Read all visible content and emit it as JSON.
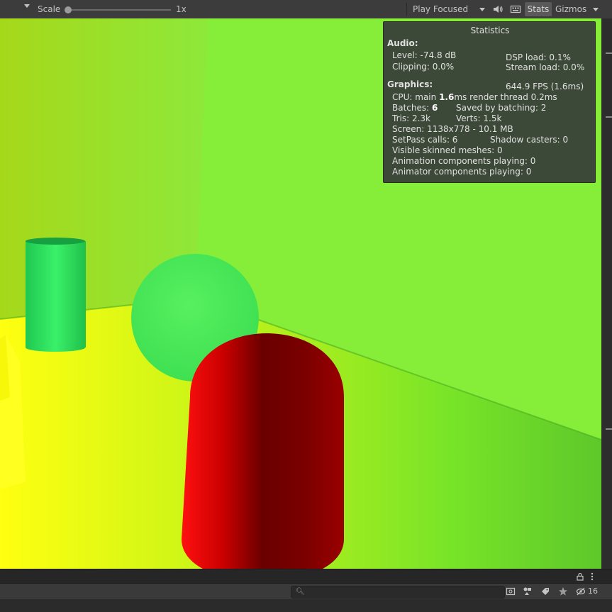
{
  "toolbar": {
    "scale_label": "Scale",
    "scale_value": "1x",
    "play_mode": "Play Focused",
    "stats_label": "Stats",
    "gizmos_label": "Gizmos"
  },
  "statistics": {
    "title": "Statistics",
    "audio_header": "Audio:",
    "level": "Level: -74.8 dB",
    "clipping": "Clipping: 0.0%",
    "dsp_load": "DSP load: 0.1%",
    "stream_load": "Stream load: 0.0%",
    "graphics_header": "Graphics:",
    "fps": "644.9 FPS (1.6ms)",
    "cpu_prefix": "CPU: main ",
    "cpu_main": "1.6",
    "cpu_suffix": "ms  render thread 0.2ms",
    "batches_prefix": "Batches: ",
    "batches_value": "6",
    "saved_by_batching": "Saved by batching: 2",
    "tris": "Tris: 2.3k",
    "verts": "Verts: 1.5k",
    "screen": "Screen: 1138x778 - 10.1 MB",
    "setpass": "SetPass calls: 6",
    "shadow_casters": "Shadow casters: 0",
    "visible_skinned": "Visible skinned meshes: 0",
    "animation_components": "Animation components playing: 0",
    "animator_components": "Animator components playing: 0"
  },
  "bottom": {
    "search_placeholder": "",
    "hidden_count": "16"
  },
  "colors": {
    "toolbar_bg": "#3c3c3c",
    "scene_green": "#7fe834",
    "capsule_red": "#d40000",
    "stats_bg": "#383c38"
  },
  "icons": [
    "dropdown-arrow-icon",
    "audio-mute-icon",
    "keyboard-icon",
    "lock-icon",
    "kebab-menu-icon",
    "search-icon",
    "scene-icon",
    "filter-type-icon",
    "label-tag-icon",
    "favorite-star-icon",
    "hidden-objects-icon"
  ]
}
